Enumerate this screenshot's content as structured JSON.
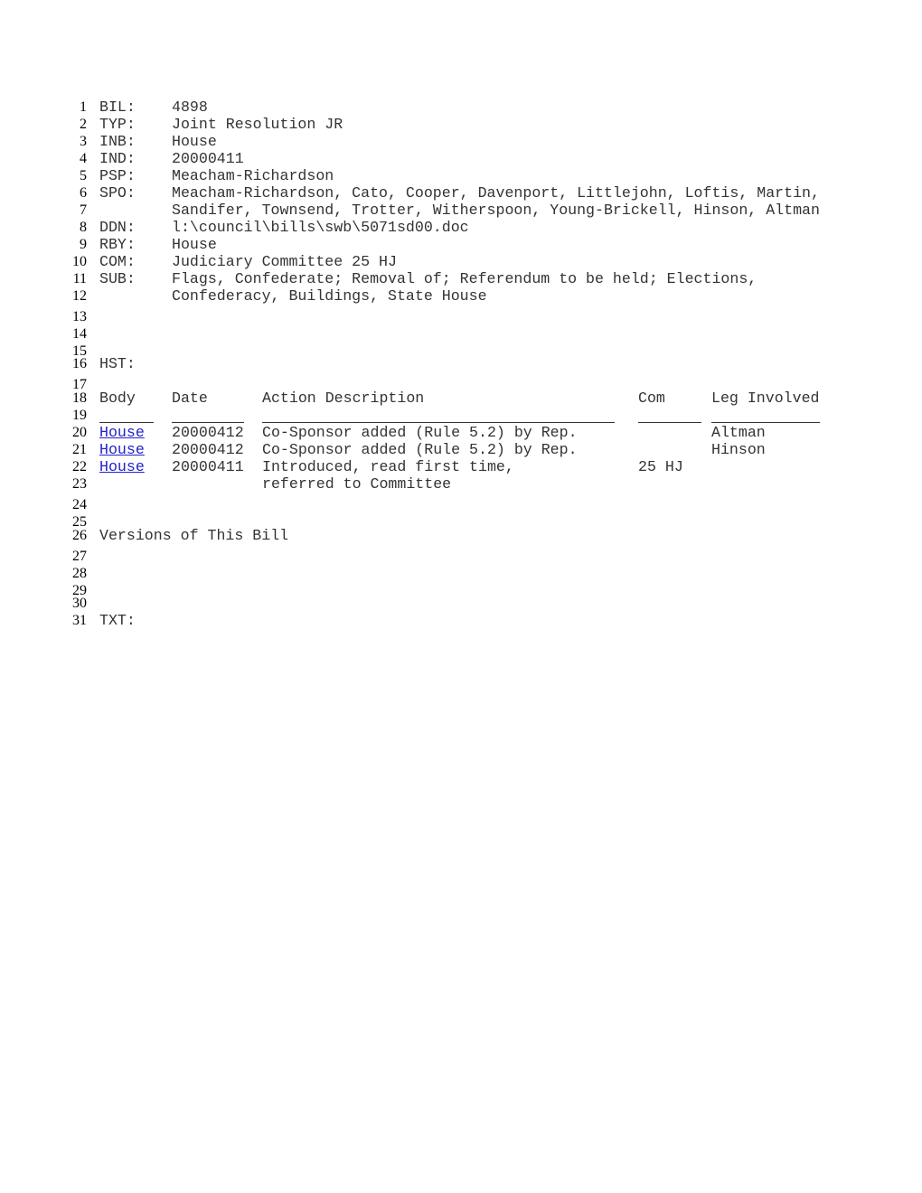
{
  "line_numbers": [
    "1",
    "2",
    "3",
    "4",
    "5",
    "6",
    "7",
    "8",
    "9",
    "10",
    "11",
    "12",
    "13",
    "14",
    "15",
    "16",
    "17",
    "18",
    "19",
    "20",
    "21",
    "22",
    "23",
    "24",
    "25",
    "26",
    "27",
    "28",
    "29",
    "30",
    "31"
  ],
  "fields": {
    "bil": {
      "label": "BIL:",
      "value": "4898"
    },
    "typ": {
      "label": "TYP:",
      "value": "Joint Resolution JR"
    },
    "inb": {
      "label": "INB:",
      "value": "House"
    },
    "ind": {
      "label": "IND:",
      "value": "20000411"
    },
    "psp": {
      "label": "PSP:",
      "value": "Meacham-Richardson"
    },
    "spo": {
      "label": "SPO:",
      "value_line1": "Meacham-Richardson, Cato, Cooper, Davenport, Littlejohn, Loftis, Martin,",
      "value_line2": "Sandifer, Townsend, Trotter, Witherspoon, Young-Brickell, Hinson, Altman"
    },
    "ddn": {
      "label": "DDN:",
      "value": "l:\\council\\bills\\swb\\5071sd00.doc"
    },
    "rby": {
      "label": "RBY:",
      "value": "House"
    },
    "com": {
      "label": "COM:",
      "value": "Judiciary Committee 25 HJ"
    },
    "sub": {
      "label": "SUB:",
      "value_line1": "Flags, Confederate; Removal of; Referendum to be held; Elections,",
      "value_line2": "Confederacy, Buildings, State House"
    }
  },
  "history": {
    "label": "HST:",
    "headers": {
      "body": "Body",
      "date": "Date",
      "action": "Action Description",
      "com": "Com",
      "leg": "Leg Involved"
    },
    "rows": [
      {
        "body": "House",
        "date": "20000412",
        "action": "Co-Sponsor added (Rule 5.2) by Rep.",
        "com": "",
        "leg": "Altman"
      },
      {
        "body": "House",
        "date": "20000412",
        "action": "Co-Sponsor added (Rule 5.2) by Rep.",
        "com": "",
        "leg": "Hinson"
      },
      {
        "body": "House",
        "date": "20000411",
        "action": "Introduced, read first time,",
        "action_cont": "referred to Committee",
        "com": "25 HJ",
        "leg": ""
      }
    ]
  },
  "versions_heading": "Versions of This Bill",
  "txt_label": "TXT:",
  "colors": {
    "link": "#2222cc",
    "text": "#333333"
  }
}
